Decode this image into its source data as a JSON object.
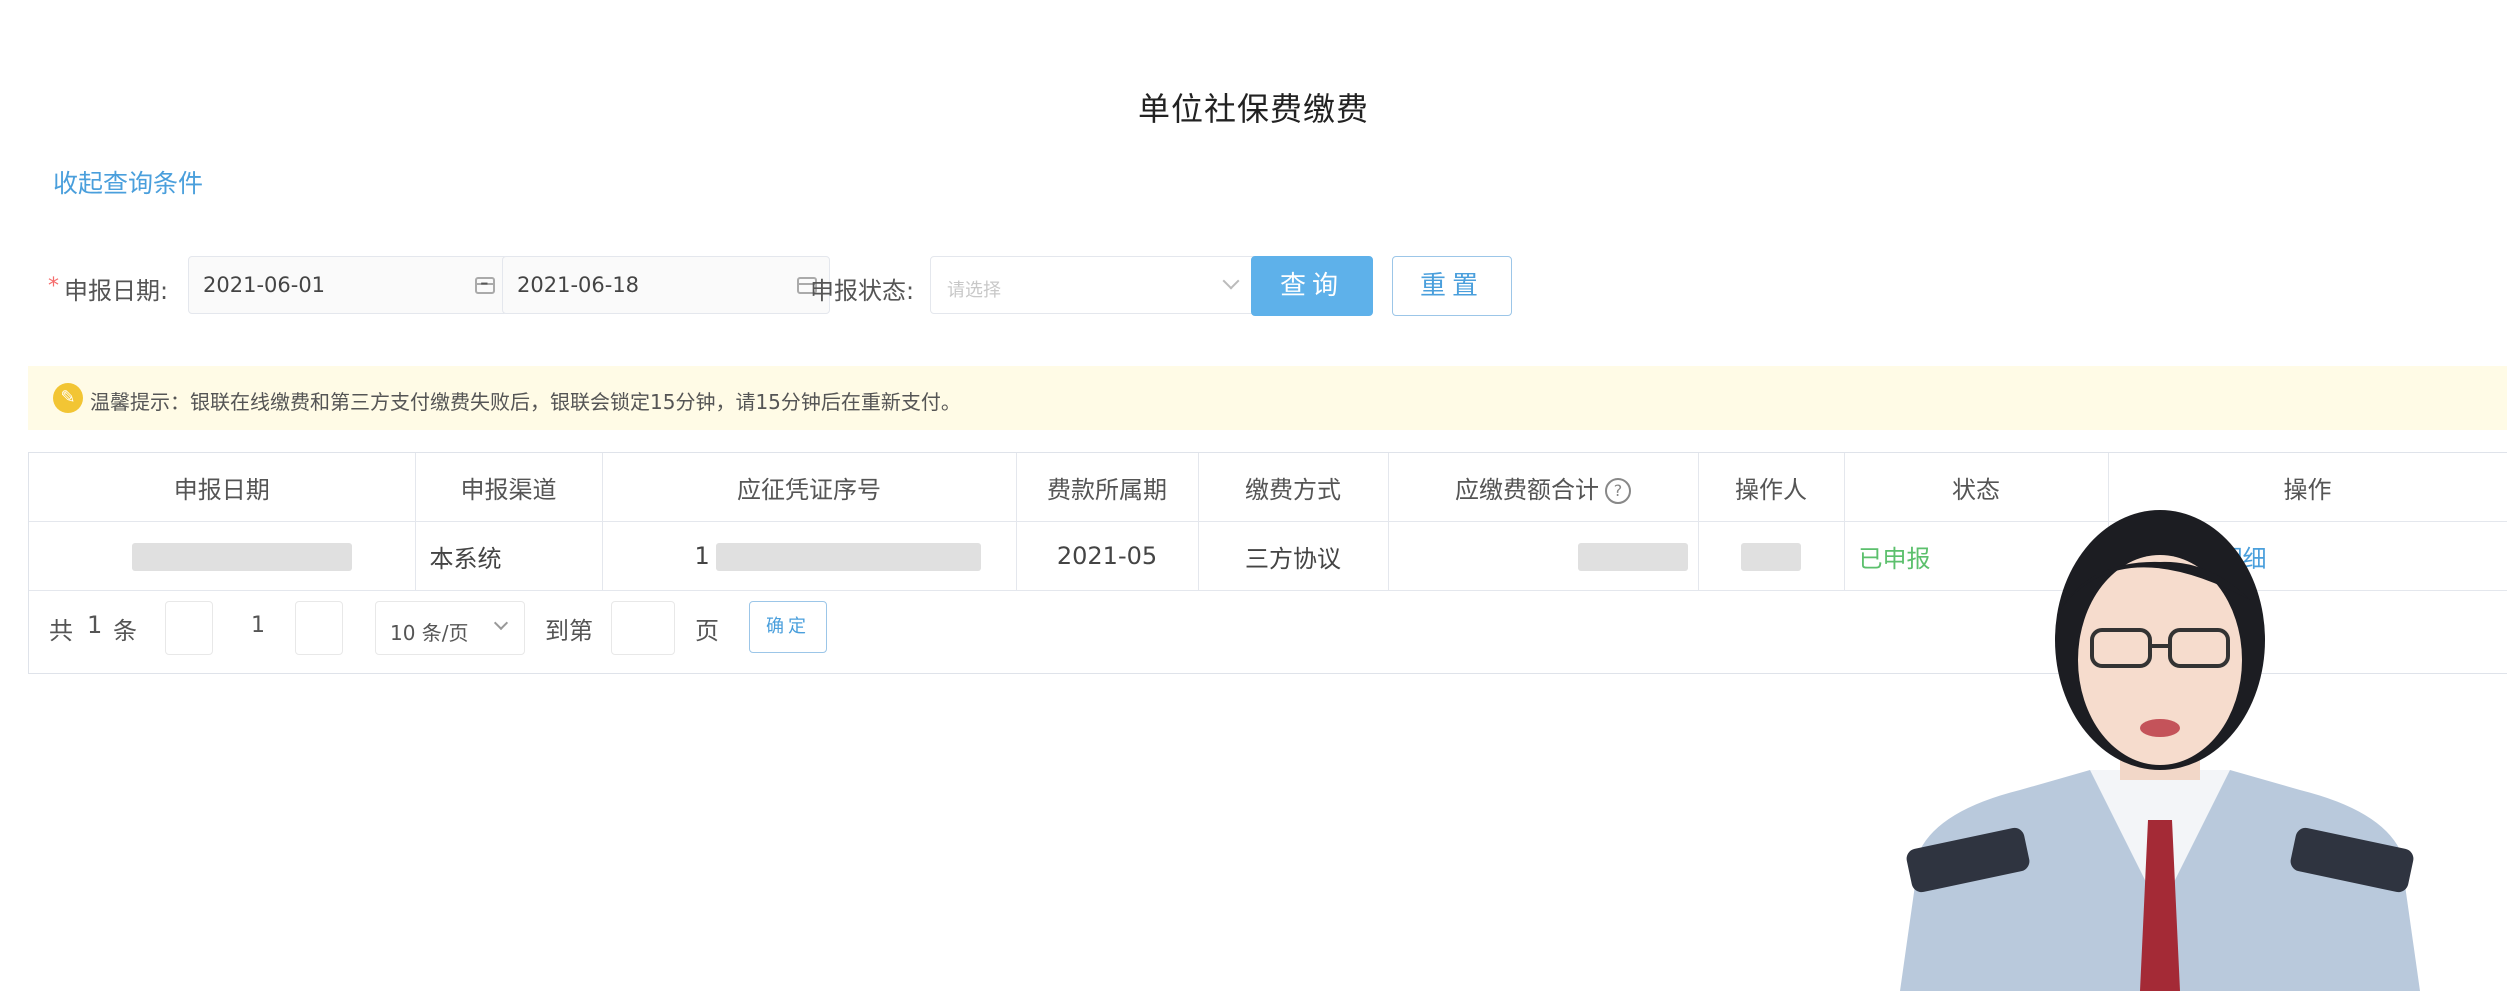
{
  "page": {
    "title": "单位社保费缴费"
  },
  "query_toggle": {
    "label": "收起查询条件"
  },
  "filters": {
    "date_label": "申报日期:",
    "date_start": "2021-06-01",
    "date_separator": "-",
    "date_end": "2021-06-18",
    "status_label": "申报状态:",
    "status_placeholder": "请选择",
    "query_button": "查询",
    "reset_button": "重置"
  },
  "tip": {
    "icon": "bulb-icon",
    "text": "温馨提示：银联在线缴费和第三方支付缴费失败后，银联会锁定15分钟，请15分钟后在重新支付。"
  },
  "table": {
    "columns": [
      "申报日期",
      "申报渠道",
      "应征凭证序号",
      "费款所属期",
      "缴费方式",
      "应缴费额合计",
      "操作人",
      "状态",
      "操作"
    ],
    "rows": [
      {
        "channel": "本系统",
        "voucher_prefix": "1",
        "period": "2021-05",
        "pay_method": "三方协议",
        "status": "已申报",
        "action": "查看申报明细"
      }
    ]
  },
  "pagination": {
    "total_prefix": "共",
    "total": "1",
    "total_suffix": "条",
    "current_page": "1",
    "page_size": "10 条/页",
    "goto_prefix": "到第",
    "goto_suffix": "页",
    "confirm": "确定"
  },
  "colors": {
    "primary": "#5eb1ea",
    "link": "#4a9fdc",
    "success": "#5cc06d",
    "tip_bg": "#fffbe6",
    "required": "#f56c6c"
  }
}
